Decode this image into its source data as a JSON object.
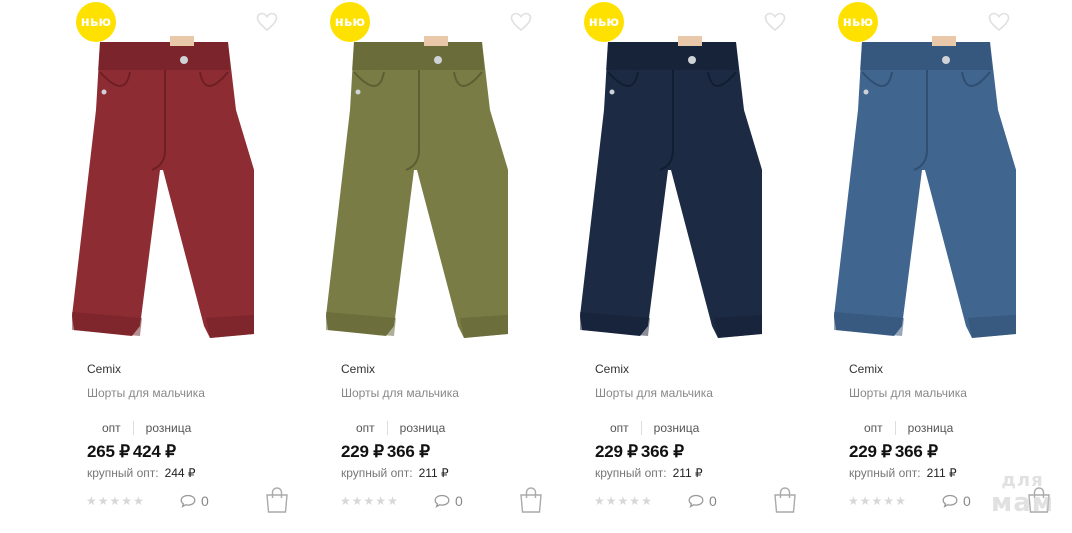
{
  "products": [
    {
      "badge": "нью",
      "brand": "Cemix",
      "name": "Шорты для мальчика",
      "tab_opt": "опт",
      "tab_retail": "розница",
      "price_opt": "265 ₽",
      "price_retail": "424 ₽",
      "bulk_label": "крупный опт:",
      "bulk_price": "244 ₽",
      "comments": "0",
      "color": "#8e2c33",
      "shade": "#6e1f25",
      "stars": [
        "★",
        "★",
        "★",
        "★",
        "★"
      ],
      "icons": {
        "wish": "heart-icon",
        "comment": "comment-icon",
        "cart": "shopping-bag-icon"
      }
    },
    {
      "badge": "нью",
      "brand": "Cemix",
      "name": "Шорты для мальчика",
      "tab_opt": "опт",
      "tab_retail": "розница",
      "price_opt": "229 ₽",
      "price_retail": "366 ₽",
      "bulk_label": "крупный опт:",
      "bulk_price": "211 ₽",
      "comments": "0",
      "color": "#7a7c45",
      "shade": "#5d5f32",
      "stars": [
        "★",
        "★",
        "★",
        "★",
        "★"
      ],
      "icons": {
        "wish": "heart-icon",
        "comment": "comment-icon",
        "cart": "shopping-bag-icon"
      }
    },
    {
      "badge": "нью",
      "brand": "Cemix",
      "name": "Шорты для мальчика",
      "tab_opt": "опт",
      "tab_retail": "розница",
      "price_opt": "229 ₽",
      "price_retail": "366 ₽",
      "bulk_label": "крупный опт:",
      "bulk_price": "211 ₽",
      "comments": "0",
      "color": "#1c2a44",
      "shade": "#131d31",
      "stars": [
        "★",
        "★",
        "★",
        "★",
        "★"
      ],
      "icons": {
        "wish": "heart-icon",
        "comment": "comment-icon",
        "cart": "shopping-bag-icon"
      }
    },
    {
      "badge": "нью",
      "brand": "Cemix",
      "name": "Шорты для мальчика",
      "tab_opt": "опт",
      "tab_retail": "розница",
      "price_opt": "229 ₽",
      "price_retail": "366 ₽",
      "bulk_label": "крупный опт:",
      "bulk_price": "211 ₽",
      "comments": "0",
      "color": "#40658e",
      "shade": "#2f4e71",
      "stars": [
        "★",
        "★",
        "★",
        "★",
        "★"
      ],
      "icons": {
        "wish": "heart-icon",
        "comment": "comment-icon",
        "cart": "shopping-bag-icon"
      }
    }
  ],
  "watermark": {
    "line1": "для",
    "line2": "мам"
  },
  "colors": {
    "badge": "#ffe100",
    "star_empty": "#d7d7d7",
    "muted_text": "#888888"
  }
}
